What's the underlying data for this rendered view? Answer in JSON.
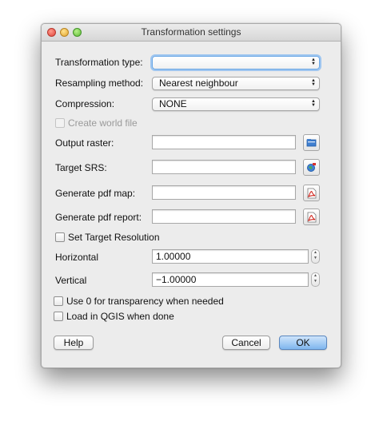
{
  "window": {
    "title": "Transformation settings"
  },
  "labels": {
    "transformation_type": "Transformation type:",
    "resampling_method": "Resampling method:",
    "compression": "Compression:",
    "output_raster": "Output raster:",
    "target_srs": "Target SRS:",
    "generate_pdf_map": "Generate pdf map:",
    "generate_pdf_report": "Generate pdf report:",
    "horizontal": "Horizontal",
    "vertical": "Vertical"
  },
  "selects": {
    "transformation_type": "",
    "resampling_method": "Nearest neighbour",
    "compression": "NONE"
  },
  "checkboxes": {
    "create_world_file": "Create world file",
    "set_target_resolution": "Set Target Resolution",
    "use_zero_transparency": "Use 0 for transparency when needed",
    "load_in_qgis": "Load in QGIS when done"
  },
  "resolution": {
    "horizontal": "1.00000",
    "vertical": "−1.00000"
  },
  "buttons": {
    "help": "Help",
    "cancel": "Cancel",
    "ok": "OK"
  },
  "icons": {
    "output_raster": "folder-icon",
    "target_srs": "globe-icon",
    "pdf_map": "pdf-icon",
    "pdf_report": "pdf-icon"
  },
  "colors": {
    "accent": "#7fb6ee",
    "focus_ring": "#9fc6f0"
  }
}
